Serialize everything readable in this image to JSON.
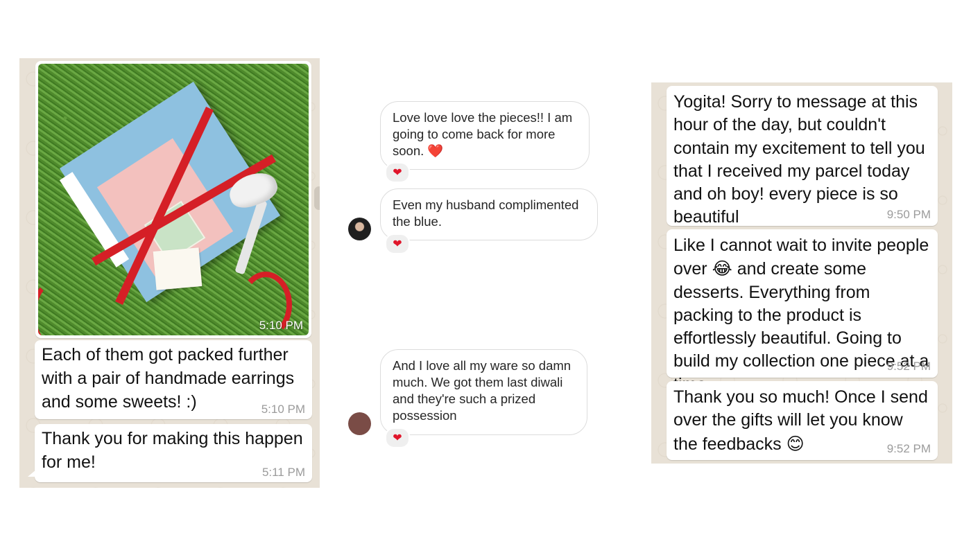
{
  "left_chat": {
    "photo_time": "5:10 PM",
    "messages": [
      {
        "text": "Each of them got packed further with a pair of handmade earrings and some sweets! :)",
        "time": "5:10 PM"
      },
      {
        "text": "Thank you for making this happen for me!",
        "time": "5:11 PM"
      }
    ]
  },
  "middle_chat": {
    "messages": [
      {
        "text": "Love love love the pieces!! I am going to come back for more soon. ❤️",
        "reaction": "❤"
      },
      {
        "text": "Even my husband complimented the blue.",
        "reaction": "❤"
      },
      {
        "text": "And I love all my ware so damn much. We got them last diwali and they're such a prized possession",
        "reaction": "❤"
      }
    ],
    "heart_color": "#e0162b"
  },
  "right_chat": {
    "messages": [
      {
        "text": "Yogita! Sorry to message at this hour of the day, but couldn't contain my excitement to tell you that I received my parcel today and oh boy! every piece is so beautiful",
        "time": "9:50 PM"
      },
      {
        "text_before": "Like I cannot wait to invite people over ",
        "emoji": "😂",
        "text_after": " and create some desserts. Everything from packing to the product is effortlessly beautiful. Going to build my collection one piece at a time.",
        "time": "9:52 PM"
      },
      {
        "text_before": "Thank you so much! Once I send over the gifts will let you know the feedbacks ",
        "emoji": "😊",
        "time": "9:52 PM"
      }
    ]
  },
  "colors": {
    "chat_bg": "#e8e1d6",
    "bubble": "#ffffff",
    "ribbon": "#d51f26",
    "box": "#8ec1e0"
  }
}
